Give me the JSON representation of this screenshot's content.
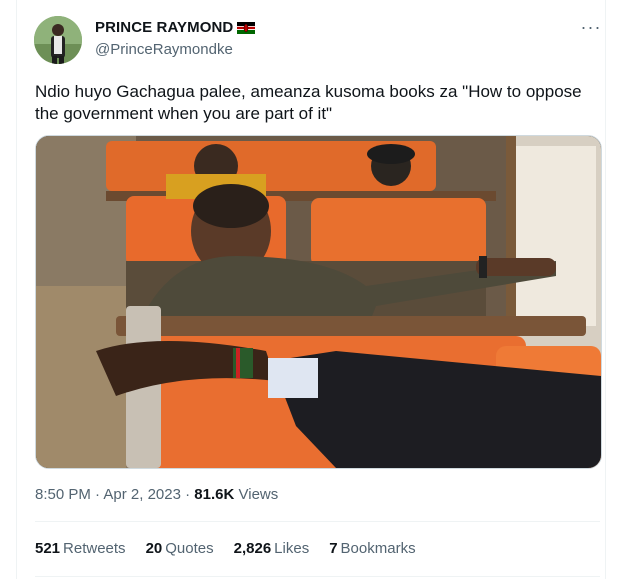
{
  "author": {
    "display_name": "PRINCE RAYMOND",
    "handle": "@PrinceRaymondke",
    "flag_icon": "kenya-flag-icon"
  },
  "tweet": {
    "text": "Ndio huyo Gachagua palee, ameanza kusoma books za \"How to oppose the government when you are part of it\"",
    "time": "8:50 PM",
    "date": "Apr 2, 2023",
    "views_count": "81.6K",
    "views_label": "Views"
  },
  "stats": [
    {
      "count": "521",
      "label": "Retweets"
    },
    {
      "count": "20",
      "label": "Quotes"
    },
    {
      "count": "2,826",
      "label": "Likes"
    },
    {
      "count": "7",
      "label": "Bookmarks"
    }
  ],
  "colors": {
    "text_primary": "#0f1419",
    "text_secondary": "#536471",
    "border": "#eff3f4",
    "seat_orange": "#e0662b"
  }
}
